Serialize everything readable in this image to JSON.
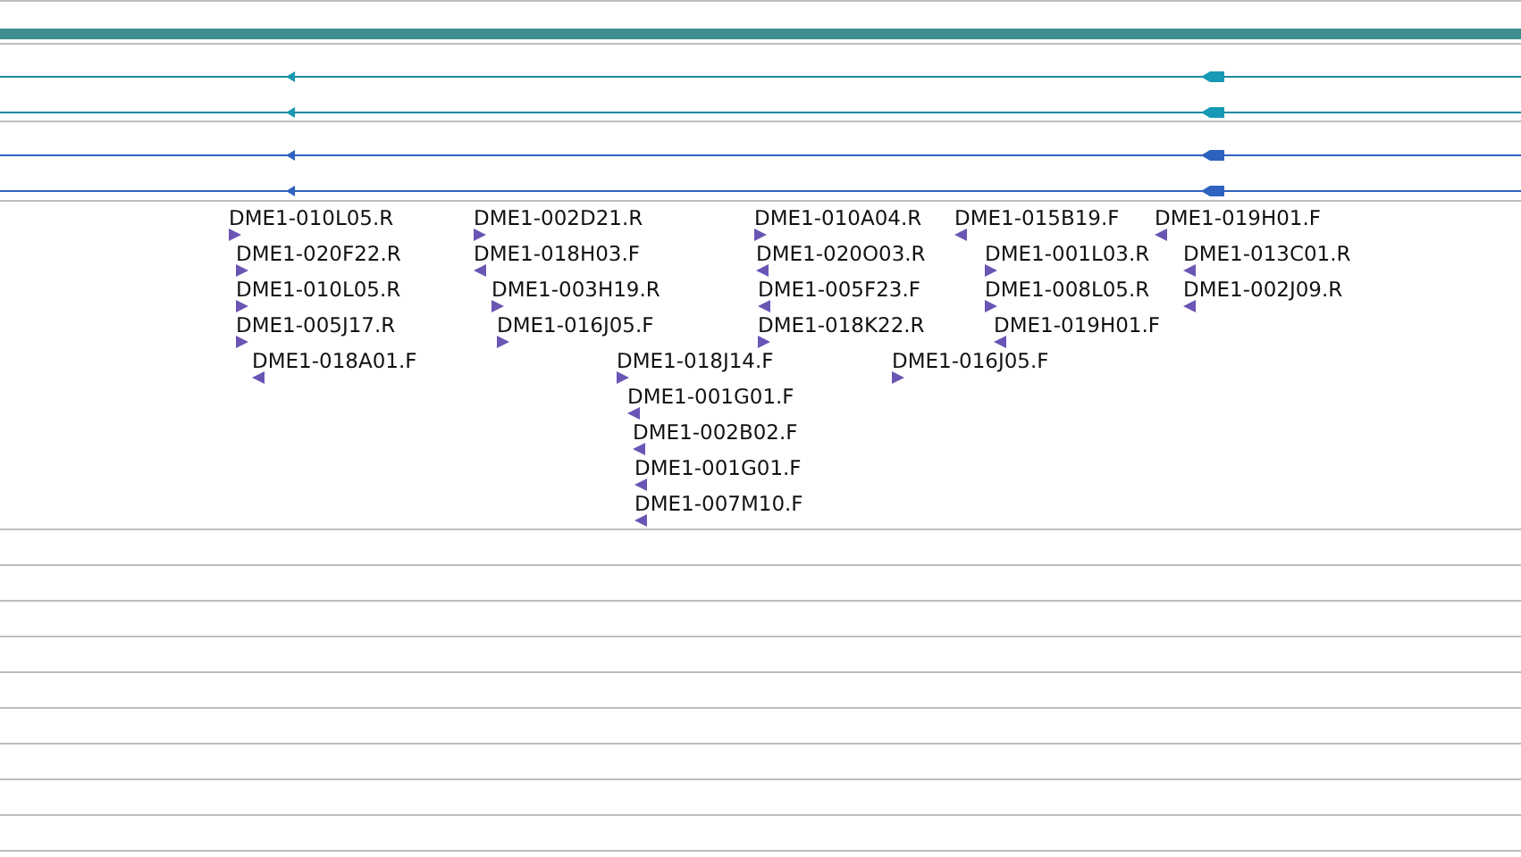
{
  "features": [
    {
      "label": "DME1-010L05.R",
      "reverse": false
    },
    {
      "label": "DME1-020F22.R",
      "reverse": false
    },
    {
      "label": "DME1-010L05.R",
      "reverse": false
    },
    {
      "label": "DME1-005J17.R",
      "reverse": false
    },
    {
      "label": "DME1-018A01.F",
      "reverse": true
    },
    {
      "label": "DME1-002D21.R",
      "reverse": false
    },
    {
      "label": "DME1-018H03.F",
      "reverse": true
    },
    {
      "label": "DME1-003H19.R",
      "reverse": false
    },
    {
      "label": "DME1-016J05.F",
      "reverse": false
    },
    {
      "label": "DME1-018J14.F",
      "reverse": false
    },
    {
      "label": "DME1-001G01.F",
      "reverse": true
    },
    {
      "label": "DME1-002B02.F",
      "reverse": true
    },
    {
      "label": "DME1-001G01.F",
      "reverse": true
    },
    {
      "label": "DME1-007M10.F",
      "reverse": true
    },
    {
      "label": "DME1-010A04.R",
      "reverse": false
    },
    {
      "label": "DME1-020O03.R",
      "reverse": true
    },
    {
      "label": "DME1-005F23.F",
      "reverse": true
    },
    {
      "label": "DME1-018K22.R",
      "reverse": false
    },
    {
      "label": "DME1-016J05.F",
      "reverse": false
    },
    {
      "label": "DME1-015B19.F",
      "reverse": true
    },
    {
      "label": "DME1-001L03.R",
      "reverse": false
    },
    {
      "label": "DME1-008L05.R",
      "reverse": false
    },
    {
      "label": "DME1-019H01.F",
      "reverse": true
    },
    {
      "label": "DME1-019H01.F",
      "reverse": true
    },
    {
      "label": "DME1-013C01.R",
      "reverse": true
    },
    {
      "label": "DME1-002J09.R",
      "reverse": true
    }
  ]
}
